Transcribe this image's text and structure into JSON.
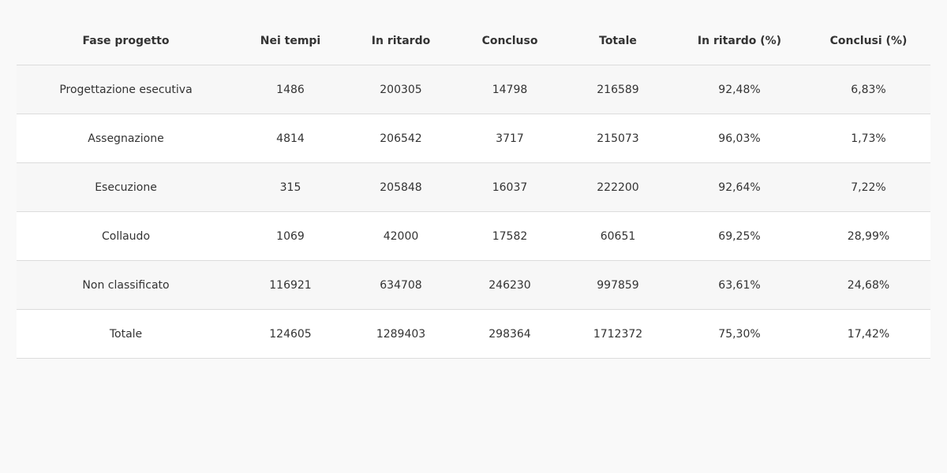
{
  "chart_data": {
    "type": "table",
    "columns": [
      "Fase progetto",
      "Nei tempi",
      "In ritardo",
      "Concluso",
      "Totale",
      "In ritardo (%)",
      "Conclusi (%)"
    ],
    "rows": [
      [
        "Progettazione esecutiva",
        "1486",
        "200305",
        "14798",
        "216589",
        "92,48%",
        "6,83%"
      ],
      [
        "Assegnazione",
        "4814",
        "206542",
        "3717",
        "215073",
        "96,03%",
        "1,73%"
      ],
      [
        "Esecuzione",
        "315",
        "205848",
        "16037",
        "222200",
        "92,64%",
        "7,22%"
      ],
      [
        "Collaudo",
        "1069",
        "42000",
        "17582",
        "60651",
        "69,25%",
        "28,99%"
      ],
      [
        "Non classificato",
        "116921",
        "634708",
        "246230",
        "997859",
        "63,61%",
        "24,68%"
      ],
      [
        "Totale",
        "124605",
        "1289403",
        "298364",
        "1712372",
        "75,30%",
        "17,42%"
      ]
    ]
  },
  "colors": {
    "background": "#f9f9f9",
    "row_odd": "#f7f7f7",
    "row_even": "#ffffff",
    "border": "#dcdcdc",
    "text": "#333333"
  }
}
